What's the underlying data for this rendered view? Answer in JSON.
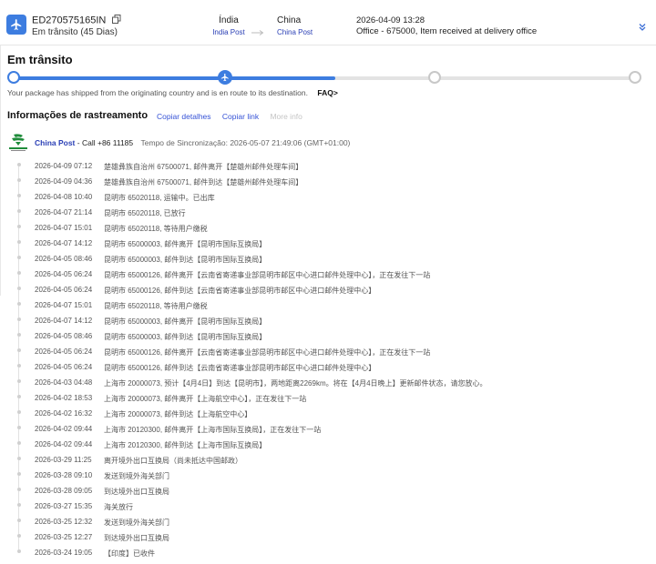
{
  "header": {
    "tracking_number": "ED270575165IN",
    "status_text": "Em trânsito (45 Dias)",
    "origin_country": "Índia",
    "origin_carrier": "India Post",
    "dest_country": "China",
    "dest_carrier": "China Post",
    "latest_time": "2026-04-09 13:28",
    "latest_desc": "Office - 675000, Item received at delivery office"
  },
  "status_title": "Em trânsito",
  "progress": {
    "current_stage": 2,
    "total_stages": 5,
    "fill_percent": 52
  },
  "note": {
    "text": "Your package has shipped from the originating country and is en route to its destination.",
    "faq": "FAQ>"
  },
  "tracking": {
    "title": "Informações de rastreamento",
    "copy_details": "Copiar detalhes",
    "copy_link": "Copiar link",
    "more_info": "More info"
  },
  "carrier": {
    "name": "China Post",
    "call": "- Call +86 11185",
    "sync": "Tempo de Sincronização: 2026-05-07 21:49:06 (GMT+01:00)"
  },
  "colors": {
    "accent": "#3d7de0",
    "link": "#3552d6",
    "carrier": "#2a3fb5"
  },
  "events": [
    {
      "time": "2026-04-09 07:12",
      "desc": "楚雄彝族自治州 67500071, 邮件离开【楚雄州邮件处理车间】"
    },
    {
      "time": "2026-04-09 04:36",
      "desc": "楚雄彝族自治州 67500071, 邮件到达【楚雄州邮件处理车间】"
    },
    {
      "time": "2026-04-08 10:40",
      "desc": "昆明市 65020118, 运输中。已出库"
    },
    {
      "time": "2026-04-07 21:14",
      "desc": "昆明市 65020118, 已放行"
    },
    {
      "time": "2026-04-07 15:01",
      "desc": "昆明市 65020118, 等待用户缴税"
    },
    {
      "time": "2026-04-07 14:12",
      "desc": "昆明市 65000003, 邮件离开【昆明市国际互换局】"
    },
    {
      "time": "2026-04-05 08:46",
      "desc": "昆明市 65000003, 邮件到达【昆明市国际互换局】"
    },
    {
      "time": "2026-04-05 06:24",
      "desc": "昆明市 65000126, 邮件离开【云南省寄递事业部昆明市邮区中心进口邮件处理中心】，正在发往下一站"
    },
    {
      "time": "2026-04-05 06:24",
      "desc": "昆明市 65000126, 邮件到达【云南省寄递事业部昆明市邮区中心进口邮件处理中心】"
    },
    {
      "time": "2026-04-07 15:01",
      "desc": "昆明市 65020118, 等待用户缴税"
    },
    {
      "time": "2026-04-07 14:12",
      "desc": "昆明市 65000003, 邮件离开【昆明市国际互换局】"
    },
    {
      "time": "2026-04-05 08:46",
      "desc": "昆明市 65000003, 邮件到达【昆明市国际互换局】"
    },
    {
      "time": "2026-04-05 06:24",
      "desc": "昆明市 65000126, 邮件离开【云南省寄递事业部昆明市邮区中心进口邮件处理中心】，正在发往下一站"
    },
    {
      "time": "2026-04-05 06:24",
      "desc": "昆明市 65000126, 邮件到达【云南省寄递事业部昆明市邮区中心进口邮件处理中心】"
    },
    {
      "time": "2026-04-03 04:48",
      "desc": "上海市 20000073, 预计【4月4日】到达【昆明市】，两地距离2269km。将在【4月4日晚上】更新邮件状态，请您放心。"
    },
    {
      "time": "2026-04-02 18:53",
      "desc": "上海市 20000073, 邮件离开【上海航空中心】，正在发往下一站"
    },
    {
      "time": "2026-04-02 16:32",
      "desc": "上海市 20000073, 邮件到达【上海航空中心】"
    },
    {
      "time": "2026-04-02 09:44",
      "desc": "上海市 20120300, 邮件离开【上海市国际互换局】，正在发往下一站"
    },
    {
      "time": "2026-04-02 09:44",
      "desc": "上海市 20120300, 邮件到达【上海市国际互换局】"
    },
    {
      "time": "2026-03-29 11:25",
      "desc": "离开境外出口互换局（尚未抵达中国邮政）"
    },
    {
      "time": "2026-03-28 09:10",
      "desc": "发送到境外海关部门"
    },
    {
      "time": "2026-03-28 09:05",
      "desc": "到达境外出口互换局"
    },
    {
      "time": "2026-03-27 15:35",
      "desc": "海关放行"
    },
    {
      "time": "2026-03-25 12:32",
      "desc": "发送到境外海关部门"
    },
    {
      "time": "2026-03-25 12:27",
      "desc": "到达境外出口互换局"
    },
    {
      "time": "2026-03-24 19:05",
      "desc": "【印度】已收件"
    }
  ]
}
